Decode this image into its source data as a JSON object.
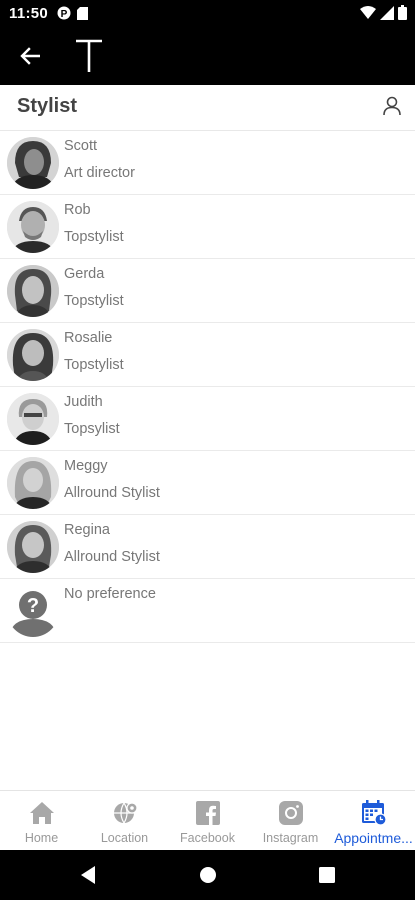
{
  "status_bar": {
    "time": "11:50"
  },
  "app_bar": {
    "back_icon": "arrow-left-icon",
    "logo_icon": "letter-t-logo"
  },
  "header": {
    "title": "Stylist",
    "profile_icon": "person-icon"
  },
  "stylists": [
    {
      "name": "Scott",
      "role": "Art director"
    },
    {
      "name": "Rob",
      "role": "Topstylist"
    },
    {
      "name": "Gerda",
      "role": "Topstylist"
    },
    {
      "name": "Rosalie",
      "role": "Topstylist"
    },
    {
      "name": "Judith",
      "role": "Topsylist"
    },
    {
      "name": "Meggy",
      "role": "Allround Stylist"
    },
    {
      "name": "Regina",
      "role": "Allround Stylist"
    },
    {
      "name": "No preference",
      "role": ""
    }
  ],
  "bottom_nav": {
    "items": [
      {
        "label": "Home",
        "icon": "home-icon"
      },
      {
        "label": "Location",
        "icon": "globe-location-icon"
      },
      {
        "label": "Facebook",
        "icon": "facebook-icon"
      },
      {
        "label": "Instagram",
        "icon": "instagram-icon"
      },
      {
        "label": "Appointme...",
        "icon": "calendar-icon"
      }
    ],
    "active_index": 4,
    "active_color": "#1e5bd9",
    "inactive_color": "#999999"
  }
}
